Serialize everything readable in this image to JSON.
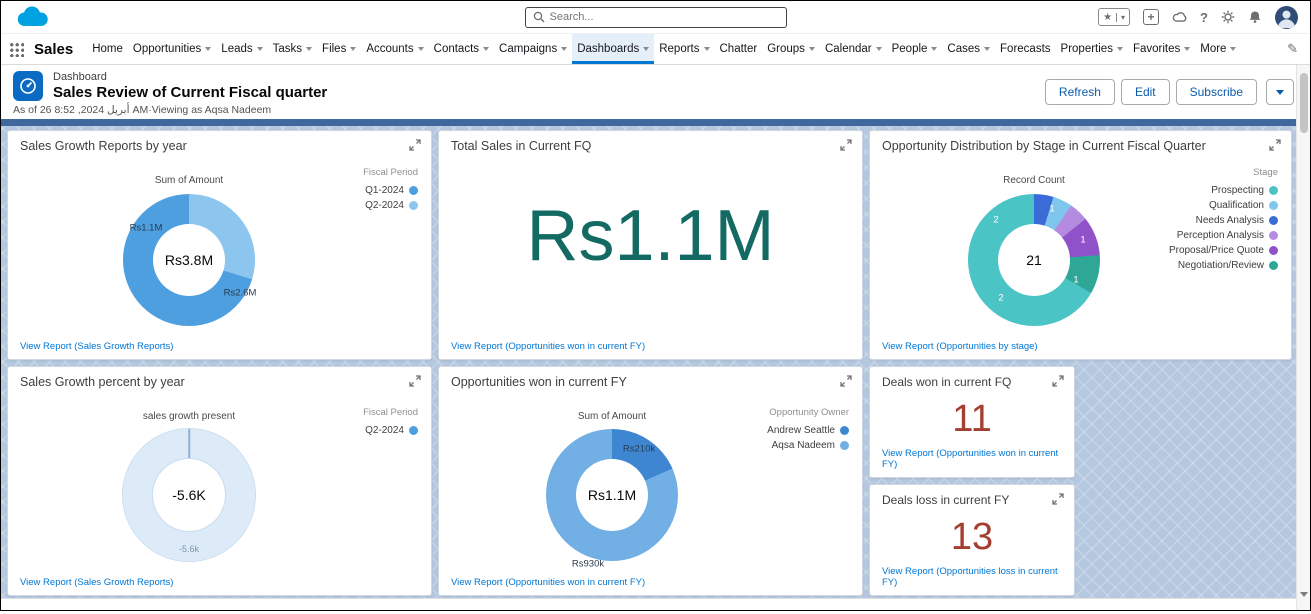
{
  "topbar": {
    "search_placeholder": "Search...",
    "icons": {
      "star": "★",
      "plus": "+",
      "question": "?"
    }
  },
  "nav": {
    "app_name": "Sales",
    "edit_icon": "✎",
    "items": [
      {
        "label": "Home"
      },
      {
        "label": "Opportunities"
      },
      {
        "label": "Leads"
      },
      {
        "label": "Tasks"
      },
      {
        "label": "Files"
      },
      {
        "label": "Accounts"
      },
      {
        "label": "Contacts"
      },
      {
        "label": "Campaigns"
      },
      {
        "label": "Dashboards",
        "active": true
      },
      {
        "label": "Reports"
      },
      {
        "label": "Chatter"
      },
      {
        "label": "Groups"
      },
      {
        "label": "Calendar"
      },
      {
        "label": "People"
      },
      {
        "label": "Cases"
      },
      {
        "label": "Forecasts"
      },
      {
        "label": "Properties"
      },
      {
        "label": "Favorites"
      },
      {
        "label": "More"
      }
    ]
  },
  "header": {
    "object_label": "Dashboard",
    "title": "Sales Review of Current Fiscal quarter",
    "meta": "As of 26 أبريل 2024, 8:52 AM·Viewing as Aqsa Nadeem",
    "buttons": {
      "refresh": "Refresh",
      "edit": "Edit",
      "subscribe": "Subscribe"
    }
  },
  "cards": [
    {
      "title": "Sales Growth Reports by year",
      "link": "View Report (Sales Growth Reports)",
      "chart": {
        "type": "donut",
        "title": "Sum of Amount",
        "center_value": "Rs3.8M",
        "slice_labels": [
          "Rs1.1M",
          "Rs2.6M"
        ],
        "segments": [
          {
            "label": "Q2-2024",
            "value": 1100000,
            "display": "Rs1.1M",
            "color": "#8CC5EE"
          },
          {
            "label": "Q1-2024",
            "value": 2600000,
            "display": "Rs2.6M",
            "color": "#4D9FE0"
          }
        ]
      },
      "legend": {
        "title": "Fiscal Period",
        "items": [
          {
            "label": "Q1-2024",
            "color": "#4D9FE0"
          },
          {
            "label": "Q2-2024",
            "color": "#8CC5EE"
          }
        ]
      }
    },
    {
      "title": "Total Sales in Current FQ",
      "link": "View Report (Opportunities won in current FY)",
      "metric": {
        "value": "Rs1.1M",
        "color": "#136A63"
      }
    },
    {
      "title": "Opportunity Distribution by Stage in Current Fiscal Quarter",
      "link": "View Report (Opportunities by stage)",
      "chart": {
        "type": "donut",
        "title": "Record Count",
        "center_value": "21",
        "slice_labels": [
          "1",
          "1",
          "1",
          "2",
          "2"
        ],
        "segments": [
          {
            "label": "Needs Analysis",
            "value": 1,
            "color": "#3B6BD6"
          },
          {
            "label": "Qualification",
            "value": 1,
            "color": "#7FC6EC"
          },
          {
            "label": "Perception Analysis",
            "value": 1,
            "color": "#B48BE0"
          },
          {
            "label": "Proposal/Price Quote",
            "value": 2,
            "color": "#8F52C8"
          },
          {
            "label": "Negotiation/Review",
            "value": 2,
            "color": "#2FA796"
          },
          {
            "label": "Prospecting",
            "value": 14,
            "color": "#4BC4C6"
          }
        ]
      },
      "legend": {
        "title": "Stage",
        "items": [
          {
            "label": "Prospecting",
            "color": "#4BC4C6"
          },
          {
            "label": "Qualification",
            "color": "#7FC6EC"
          },
          {
            "label": "Needs Analysis",
            "color": "#3B6BD6"
          },
          {
            "label": "Perception Analysis",
            "color": "#B48BE0"
          },
          {
            "label": "Proposal/Price Quote",
            "color": "#8F52C8"
          },
          {
            "label": "Negotiation/Review",
            "color": "#2FA796"
          }
        ]
      }
    },
    {
      "title": "Sales Growth percent by year",
      "link": "View Report (Sales Growth Reports)",
      "chart": {
        "type": "donut",
        "title": "sales growth present",
        "center_value": "-5.6K",
        "bottom_label": "-5.6k",
        "segments": [
          {
            "label": "Q2-2024",
            "value": 1,
            "color": "#DDEAF8"
          }
        ]
      },
      "legend": {
        "title": "Fiscal Period",
        "items": [
          {
            "label": "Q2-2024",
            "color": "#4D9FE0"
          }
        ]
      }
    },
    {
      "title": "Opportunities won in current FY",
      "link": "View Report (Opportunities won in current FY)",
      "chart": {
        "type": "donut",
        "title": "Sum of Amount",
        "center_value": "Rs1.1M",
        "slice_labels": [
          "Rs210k",
          "Rs930k"
        ],
        "segments": [
          {
            "label": "Andrew Seattle",
            "value": 210000,
            "display": "Rs210k",
            "color": "#3F86D2"
          },
          {
            "label": "Aqsa Nadeem",
            "value": 930000,
            "display": "Rs930k",
            "color": "#72AFE5"
          }
        ]
      },
      "legend": {
        "title": "Opportunity Owner",
        "items": [
          {
            "label": "Andrew Seattle",
            "color": "#3F86D2"
          },
          {
            "label": "Aqsa Nadeem",
            "color": "#72AFE5"
          }
        ]
      }
    },
    {
      "title": "Deals won in current FQ",
      "link": "View Report (Opportunities won in current FY)",
      "metric": {
        "value": "11",
        "color": "#A33E30"
      }
    },
    {
      "title": "Deals loss in current FY",
      "link": "View Report (Opportunities loss in current FY)",
      "metric": {
        "value": "13",
        "color": "#A33E30"
      }
    }
  ]
}
